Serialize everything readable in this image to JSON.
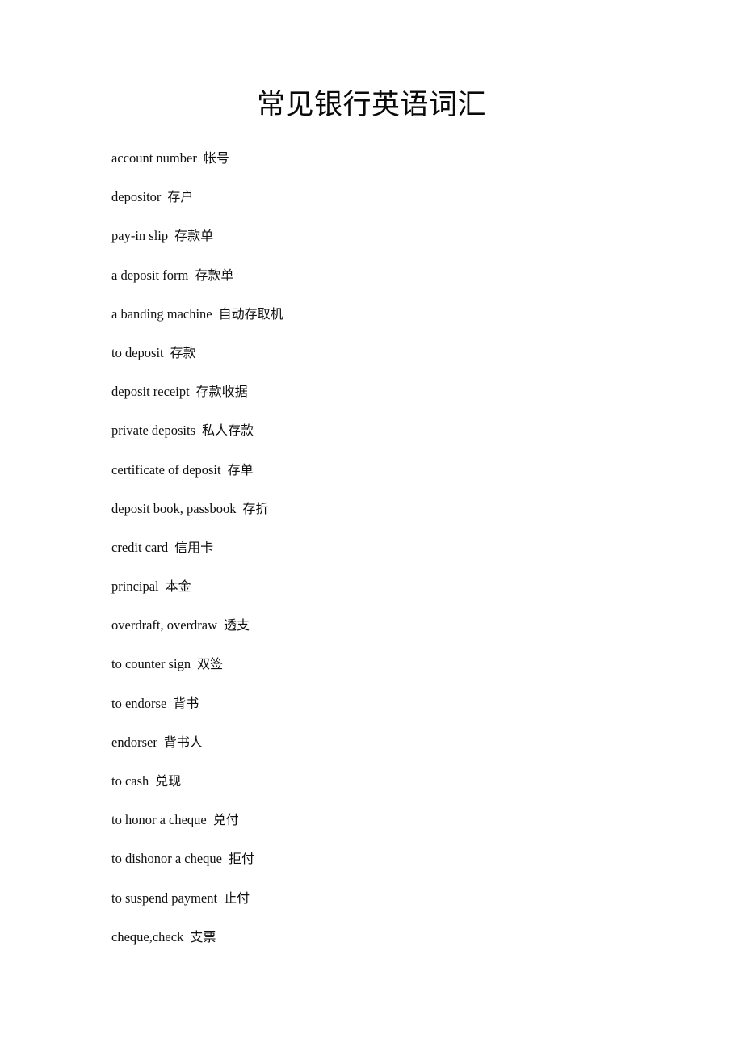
{
  "document": {
    "title": "常见银行英语词汇",
    "page_background": "#ffffff",
    "text_color": "#101010"
  },
  "glossary": {
    "entries": [
      {
        "term": "account number",
        "gloss": "帐号"
      },
      {
        "term": "depositor",
        "gloss": "存户"
      },
      {
        "term": "pay-in slip",
        "gloss": "存款单"
      },
      {
        "term": "a deposit form",
        "gloss": "存款单"
      },
      {
        "term": "a banding machine",
        "gloss": "自动存取机"
      },
      {
        "term": "to deposit",
        "gloss": "存款"
      },
      {
        "term": "deposit receipt",
        "gloss": "存款收据"
      },
      {
        "term": "private deposits",
        "gloss": "私人存款"
      },
      {
        "term": "certificate of deposit",
        "gloss": "存单"
      },
      {
        "term": "deposit book, passbook",
        "gloss": "存折"
      },
      {
        "term": "credit card",
        "gloss": "信用卡"
      },
      {
        "term": "principal",
        "gloss": "本金"
      },
      {
        "term": "overdraft, overdraw",
        "gloss": "透支"
      },
      {
        "term": "to counter sign",
        "gloss": "双签"
      },
      {
        "term": "to endorse",
        "gloss": "背书"
      },
      {
        "term": "endorser",
        "gloss": "背书人"
      },
      {
        "term": "to cash",
        "gloss": "兑现"
      },
      {
        "term": "to honor a cheque",
        "gloss": "兑付"
      },
      {
        "term": "to dishonor a cheque",
        "gloss": "拒付"
      },
      {
        "term": "to suspend payment",
        "gloss": "止付"
      },
      {
        "term": "cheque,check",
        "gloss": "支票"
      }
    ]
  }
}
